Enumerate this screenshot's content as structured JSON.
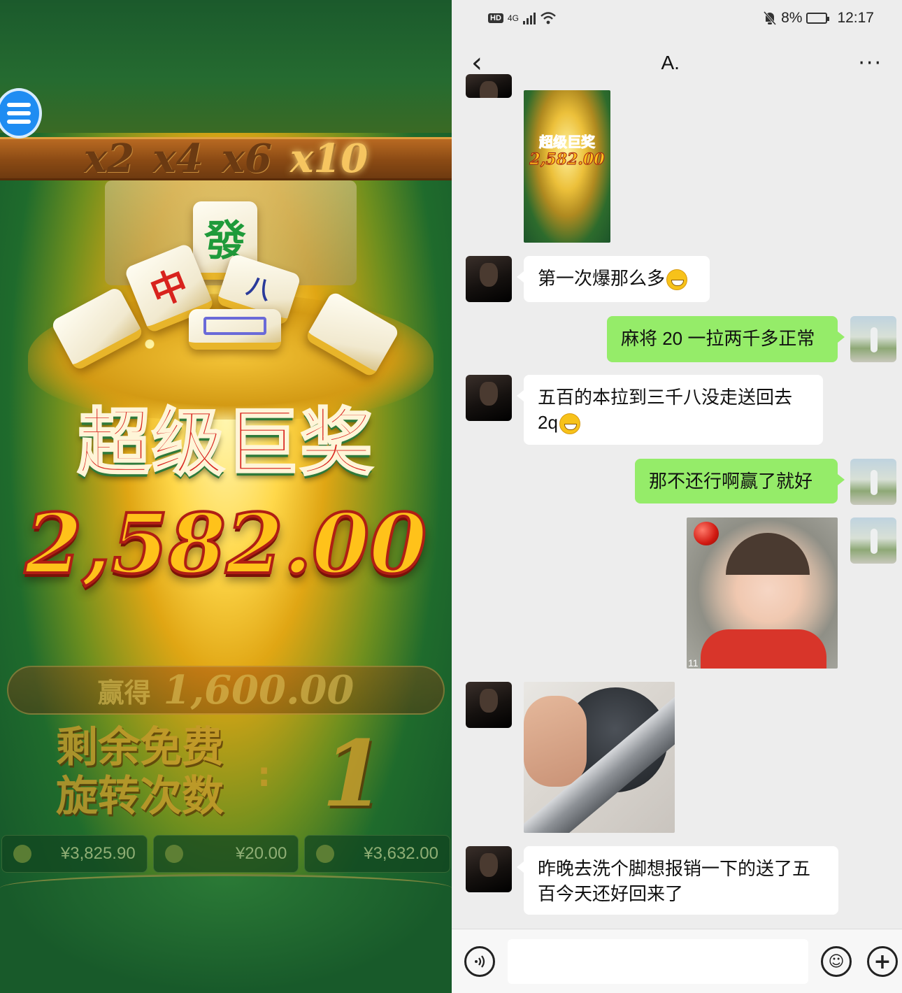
{
  "game": {
    "multipliers": [
      "x2",
      "x4",
      "x6",
      "x10"
    ],
    "active_multiplier": "x10",
    "jackpot_title": "超级巨奖",
    "jackpot_amount": "2,582.00",
    "win_label": "赢得",
    "win_amount": "1,600.00",
    "free_spins_label_line1": "剩余免费",
    "free_spins_label_line2": "旋转次数",
    "free_spins_colon": ":",
    "free_spins_count": "1",
    "stats": [
      {
        "icon": "wallet-icon",
        "value": "¥3,825.90"
      },
      {
        "icon": "coin-stack-icon",
        "value": "¥20.00"
      },
      {
        "icon": "win-chest-icon",
        "value": "¥3,632.00"
      }
    ],
    "tiles": [
      "發",
      "中",
      "八"
    ]
  },
  "chat": {
    "status_bar": {
      "network": "4G",
      "hd": "HD",
      "battery": "8%",
      "time": "12:17"
    },
    "header": {
      "back": "‹",
      "title": "A.",
      "more": "···"
    },
    "messages": [
      {
        "side": "in",
        "type": "image",
        "image": "jackpot-screenshot",
        "thumb_title": "超级巨奖",
        "thumb_amount": "2,582.00"
      },
      {
        "side": "in",
        "type": "text",
        "text": "第一次爆那么多",
        "emoji": "grin-emoji"
      },
      {
        "side": "out",
        "type": "text",
        "text": "麻将 20 一拉两千多正常"
      },
      {
        "side": "in",
        "type": "text",
        "text_line1": "五百的本拉到三千八没走送回去",
        "text_line2": "2q",
        "emoji": "dizzy-emoji"
      },
      {
        "side": "out",
        "type": "text",
        "text": "那不还行啊赢了就好"
      },
      {
        "side": "out",
        "type": "image",
        "image": "smiling-baby-photo",
        "corner_text": "11"
      },
      {
        "side": "in",
        "type": "image",
        "image": "cat-and-knife-photo"
      },
      {
        "side": "in",
        "type": "text",
        "text_line1": "昨晚去洗个脚想报销一下的送了五",
        "text_line2": "百今天还好回来了"
      }
    ],
    "input": {
      "value": "",
      "plus": "+",
      "emoji": "☺"
    }
  }
}
